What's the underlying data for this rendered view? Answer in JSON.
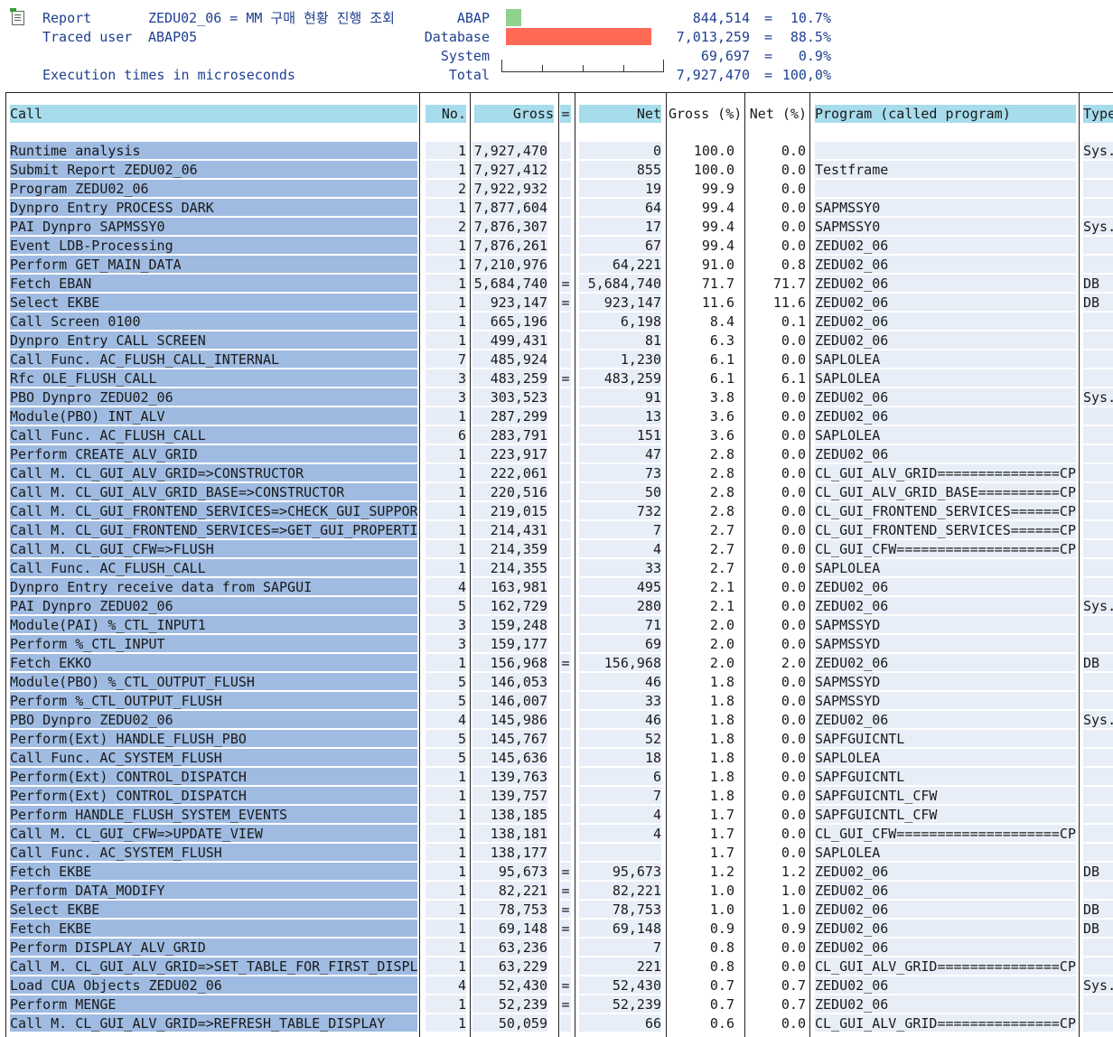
{
  "header": {
    "report_label": "Report",
    "report_value": "ZEDU02_06 = MM 구매 현황 진행 조회",
    "traced_label": "Traced user",
    "traced_value": "ABAP05",
    "exec_text": "Execution times in microseconds",
    "stats": [
      {
        "label": "ABAP",
        "value": "844,514",
        "eq": "=",
        "pct": "10.7%"
      },
      {
        "label": "Database",
        "value": "7,013,259",
        "eq": "=",
        "pct": "88.5%"
      },
      {
        "label": "System",
        "value": "69,697",
        "eq": "=",
        "pct": "0.9%"
      },
      {
        "label": "Total",
        "value": "7,927,470",
        "eq": "=",
        "pct": "100,0%"
      }
    ],
    "bar_colors": {
      "abap": "#8fd18f",
      "database": "#ff6a55"
    },
    "bar_fractions": {
      "abap": 0.107,
      "database": 0.885
    }
  },
  "columns": {
    "call": "Call",
    "no": "No.",
    "gross": "Gross",
    "eq": "=",
    "net": "Net",
    "gross_pct": "Gross (%)",
    "net_pct": "Net (%)",
    "program": "Program (called program)",
    "type": "Type"
  },
  "rows": [
    {
      "call": "Runtime analysis",
      "no": "1",
      "gross": "7,927,470",
      "eq": "",
      "net": "0",
      "gp": "100.0",
      "np": "0.0",
      "prog": "",
      "type": "Sys."
    },
    {
      "call": "Submit Report ZEDU02_06",
      "no": "1",
      "gross": "7,927,412",
      "eq": "",
      "net": "855",
      "gp": "100.0",
      "np": "0.0",
      "prog": "Testframe",
      "type": ""
    },
    {
      "call": "Program ZEDU02_06",
      "no": "2",
      "gross": "7,922,932",
      "eq": "",
      "net": "19",
      "gp": "99.9",
      "np": "0.0",
      "prog": "",
      "type": ""
    },
    {
      "call": "Dynpro Entry PROCESS DARK",
      "no": "1",
      "gross": "7,877,604",
      "eq": "",
      "net": "64",
      "gp": "99.4",
      "np": "0.0",
      "prog": "SAPMSSY0",
      "type": ""
    },
    {
      "call": "PAI Dynpro SAPMSSY0",
      "no": "2",
      "gross": "7,876,307",
      "eq": "",
      "net": "17",
      "gp": "99.4",
      "np": "0.0",
      "prog": "SAPMSSY0",
      "type": "Sys."
    },
    {
      "call": "Event LDB-Processing",
      "no": "1",
      "gross": "7,876,261",
      "eq": "",
      "net": "67",
      "gp": "99.4",
      "np": "0.0",
      "prog": "ZEDU02_06",
      "type": ""
    },
    {
      "call": "Perform GET_MAIN_DATA",
      "no": "1",
      "gross": "7,210,976",
      "eq": "",
      "net": "64,221",
      "gp": "91.0",
      "np": "0.8",
      "prog": "ZEDU02_06",
      "type": ""
    },
    {
      "call": "Fetch EBAN",
      "no": "1",
      "gross": "5,684,740",
      "eq": "=",
      "net": "5,684,740",
      "gp": "71.7",
      "np": "71.7",
      "prog": "ZEDU02_06",
      "type": "DB"
    },
    {
      "call": "Select EKBE",
      "no": "1",
      "gross": "923,147",
      "eq": "=",
      "net": "923,147",
      "gp": "11.6",
      "np": "11.6",
      "prog": "ZEDU02_06",
      "type": "DB"
    },
    {
      "call": "Call Screen 0100",
      "no": "1",
      "gross": "665,196",
      "eq": "",
      "net": "6,198",
      "gp": "8.4",
      "np": "0.1",
      "prog": "ZEDU02_06",
      "type": ""
    },
    {
      "call": "Dynpro Entry CALL SCREEN",
      "no": "1",
      "gross": "499,431",
      "eq": "",
      "net": "81",
      "gp": "6.3",
      "np": "0.0",
      "prog": "ZEDU02_06",
      "type": ""
    },
    {
      "call": "Call Func. AC_FLUSH_CALL_INTERNAL",
      "no": "7",
      "gross": "485,924",
      "eq": "",
      "net": "1,230",
      "gp": "6.1",
      "np": "0.0",
      "prog": "SAPLOLEA",
      "type": ""
    },
    {
      "call": "Rfc OLE_FLUSH_CALL",
      "no": "3",
      "gross": "483,259",
      "eq": "=",
      "net": "483,259",
      "gp": "6.1",
      "np": "6.1",
      "prog": "SAPLOLEA",
      "type": ""
    },
    {
      "call": "PBO Dynpro ZEDU02_06",
      "no": "3",
      "gross": "303,523",
      "eq": "",
      "net": "91",
      "gp": "3.8",
      "np": "0.0",
      "prog": "ZEDU02_06",
      "type": "Sys."
    },
    {
      "call": "Module(PBO) INT_ALV",
      "no": "1",
      "gross": "287,299",
      "eq": "",
      "net": "13",
      "gp": "3.6",
      "np": "0.0",
      "prog": "ZEDU02_06",
      "type": ""
    },
    {
      "call": "Call Func. AC_FLUSH_CALL",
      "no": "6",
      "gross": "283,791",
      "eq": "",
      "net": "151",
      "gp": "3.6",
      "np": "0.0",
      "prog": "SAPLOLEA",
      "type": ""
    },
    {
      "call": "Perform CREATE_ALV_GRID",
      "no": "1",
      "gross": "223,917",
      "eq": "",
      "net": "47",
      "gp": "2.8",
      "np": "0.0",
      "prog": "ZEDU02_06",
      "type": ""
    },
    {
      "call": "Call M. CL_GUI_ALV_GRID=>CONSTRUCTOR",
      "no": "1",
      "gross": "222,061",
      "eq": "",
      "net": "73",
      "gp": "2.8",
      "np": "0.0",
      "prog": "CL_GUI_ALV_GRID===============CP",
      "type": ""
    },
    {
      "call": "Call M. CL_GUI_ALV_GRID_BASE=>CONSTRUCTOR",
      "no": "1",
      "gross": "220,516",
      "eq": "",
      "net": "50",
      "gp": "2.8",
      "np": "0.0",
      "prog": "CL_GUI_ALV_GRID_BASE==========CP",
      "type": ""
    },
    {
      "call": "Call M. CL_GUI_FRONTEND_SERVICES=>CHECK_GUI_SUPPOR",
      "no": "1",
      "gross": "219,015",
      "eq": "",
      "net": "732",
      "gp": "2.8",
      "np": "0.0",
      "prog": "CL_GUI_FRONTEND_SERVICES======CP",
      "type": ""
    },
    {
      "call": "Call M. CL_GUI_FRONTEND_SERVICES=>GET_GUI_PROPERTI",
      "no": "1",
      "gross": "214,431",
      "eq": "",
      "net": "7",
      "gp": "2.7",
      "np": "0.0",
      "prog": "CL_GUI_FRONTEND_SERVICES======CP",
      "type": ""
    },
    {
      "call": "Call M. CL_GUI_CFW=>FLUSH",
      "no": "1",
      "gross": "214,359",
      "eq": "",
      "net": "4",
      "gp": "2.7",
      "np": "0.0",
      "prog": "CL_GUI_CFW====================CP",
      "type": ""
    },
    {
      "call": "Call Func. AC_FLUSH_CALL",
      "no": "1",
      "gross": "214,355",
      "eq": "",
      "net": "33",
      "gp": "2.7",
      "np": "0.0",
      "prog": "SAPLOLEA",
      "type": ""
    },
    {
      "call": "Dynpro Entry receive data from SAPGUI",
      "no": "4",
      "gross": "163,981",
      "eq": "",
      "net": "495",
      "gp": "2.1",
      "np": "0.0",
      "prog": "ZEDU02_06",
      "type": ""
    },
    {
      "call": "PAI Dynpro ZEDU02_06",
      "no": "5",
      "gross": "162,729",
      "eq": "",
      "net": "280",
      "gp": "2.1",
      "np": "0.0",
      "prog": "ZEDU02_06",
      "type": "Sys."
    },
    {
      "call": "Module(PAI) %_CTL_INPUT1",
      "no": "3",
      "gross": "159,248",
      "eq": "",
      "net": "71",
      "gp": "2.0",
      "np": "0.0",
      "prog": "SAPMSSYD",
      "type": ""
    },
    {
      "call": "Perform %_CTL_INPUT",
      "no": "3",
      "gross": "159,177",
      "eq": "",
      "net": "69",
      "gp": "2.0",
      "np": "0.0",
      "prog": "SAPMSSYD",
      "type": ""
    },
    {
      "call": "Fetch EKKO",
      "no": "1",
      "gross": "156,968",
      "eq": "=",
      "net": "156,968",
      "gp": "2.0",
      "np": "2.0",
      "prog": "ZEDU02_06",
      "type": "DB"
    },
    {
      "call": "Module(PBO) %_CTL_OUTPUT_FLUSH",
      "no": "5",
      "gross": "146,053",
      "eq": "",
      "net": "46",
      "gp": "1.8",
      "np": "0.0",
      "prog": "SAPMSSYD",
      "type": ""
    },
    {
      "call": "Perform %_CTL_OUTPUT_FLUSH",
      "no": "5",
      "gross": "146,007",
      "eq": "",
      "net": "33",
      "gp": "1.8",
      "np": "0.0",
      "prog": "SAPMSSYD",
      "type": ""
    },
    {
      "call": "PBO Dynpro ZEDU02_06",
      "no": "4",
      "gross": "145,986",
      "eq": "",
      "net": "46",
      "gp": "1.8",
      "np": "0.0",
      "prog": "ZEDU02_06",
      "type": "Sys."
    },
    {
      "call": "Perform(Ext) HANDLE_FLUSH_PBO",
      "no": "5",
      "gross": "145,767",
      "eq": "",
      "net": "52",
      "gp": "1.8",
      "np": "0.0",
      "prog": "SAPFGUICNTL",
      "type": ""
    },
    {
      "call": "Call Func. AC_SYSTEM_FLUSH",
      "no": "5",
      "gross": "145,636",
      "eq": "",
      "net": "18",
      "gp": "1.8",
      "np": "0.0",
      "prog": "SAPLOLEA",
      "type": ""
    },
    {
      "call": "Perform(Ext) CONTROL_DISPATCH",
      "no": "1",
      "gross": "139,763",
      "eq": "",
      "net": "6",
      "gp": "1.8",
      "np": "0.0",
      "prog": "SAPFGUICNTL",
      "type": ""
    },
    {
      "call": "Perform(Ext) CONTROL_DISPATCH",
      "no": "1",
      "gross": "139,757",
      "eq": "",
      "net": "7",
      "gp": "1.8",
      "np": "0.0",
      "prog": "SAPFGUICNTL_CFW",
      "type": ""
    },
    {
      "call": "Perform HANDLE_FLUSH_SYSTEM_EVENTS",
      "no": "1",
      "gross": "138,185",
      "eq": "",
      "net": "4",
      "gp": "1.7",
      "np": "0.0",
      "prog": "SAPFGUICNTL_CFW",
      "type": ""
    },
    {
      "call": "Call M. CL_GUI_CFW=>UPDATE_VIEW",
      "no": "1",
      "gross": "138,181",
      "eq": "",
      "net": "4",
      "gp": "1.7",
      "np": "0.0",
      "prog": "CL_GUI_CFW====================CP",
      "type": ""
    },
    {
      "call": "Call Func. AC_SYSTEM_FLUSH",
      "no": "1",
      "gross": "138,177",
      "eq": "",
      "net": "",
      "gp": "1.7",
      "np": "0.0",
      "prog": "SAPLOLEA",
      "type": ""
    },
    {
      "call": "Fetch EKBE",
      "no": "1",
      "gross": "95,673",
      "eq": "=",
      "net": "95,673",
      "gp": "1.2",
      "np": "1.2",
      "prog": "ZEDU02_06",
      "type": "DB"
    },
    {
      "call": "Perform DATA_MODIFY",
      "no": "1",
      "gross": "82,221",
      "eq": "=",
      "net": "82,221",
      "gp": "1.0",
      "np": "1.0",
      "prog": "ZEDU02_06",
      "type": ""
    },
    {
      "call": "Select EKBE",
      "no": "1",
      "gross": "78,753",
      "eq": "=",
      "net": "78,753",
      "gp": "1.0",
      "np": "1.0",
      "prog": "ZEDU02_06",
      "type": "DB"
    },
    {
      "call": "Fetch EKBE",
      "no": "1",
      "gross": "69,148",
      "eq": "=",
      "net": "69,148",
      "gp": "0.9",
      "np": "0.9",
      "prog": "ZEDU02_06",
      "type": "DB"
    },
    {
      "call": "Perform DISPLAY_ALV_GRID",
      "no": "1",
      "gross": "63,236",
      "eq": "",
      "net": "7",
      "gp": "0.8",
      "np": "0.0",
      "prog": "ZEDU02_06",
      "type": ""
    },
    {
      "call": "Call M. CL_GUI_ALV_GRID=>SET_TABLE_FOR_FIRST_DISPL",
      "no": "1",
      "gross": "63,229",
      "eq": "",
      "net": "221",
      "gp": "0.8",
      "np": "0.0",
      "prog": "CL_GUI_ALV_GRID===============CP",
      "type": ""
    },
    {
      "call": "Load CUA Objects ZEDU02_06",
      "no": "4",
      "gross": "52,430",
      "eq": "=",
      "net": "52,430",
      "gp": "0.7",
      "np": "0.7",
      "prog": "ZEDU02_06",
      "type": "Sys."
    },
    {
      "call": "Perform MENGE",
      "no": "1",
      "gross": "52,239",
      "eq": "=",
      "net": "52,239",
      "gp": "0.7",
      "np": "0.7",
      "prog": "ZEDU02_06",
      "type": ""
    },
    {
      "call": "Call M. CL_GUI_ALV_GRID=>REFRESH_TABLE_DISPLAY",
      "no": "1",
      "gross": "50,059",
      "eq": "",
      "net": "66",
      "gp": "0.6",
      "np": "0.0",
      "prog": "CL_GUI_ALV_GRID===============CP",
      "type": ""
    }
  ]
}
